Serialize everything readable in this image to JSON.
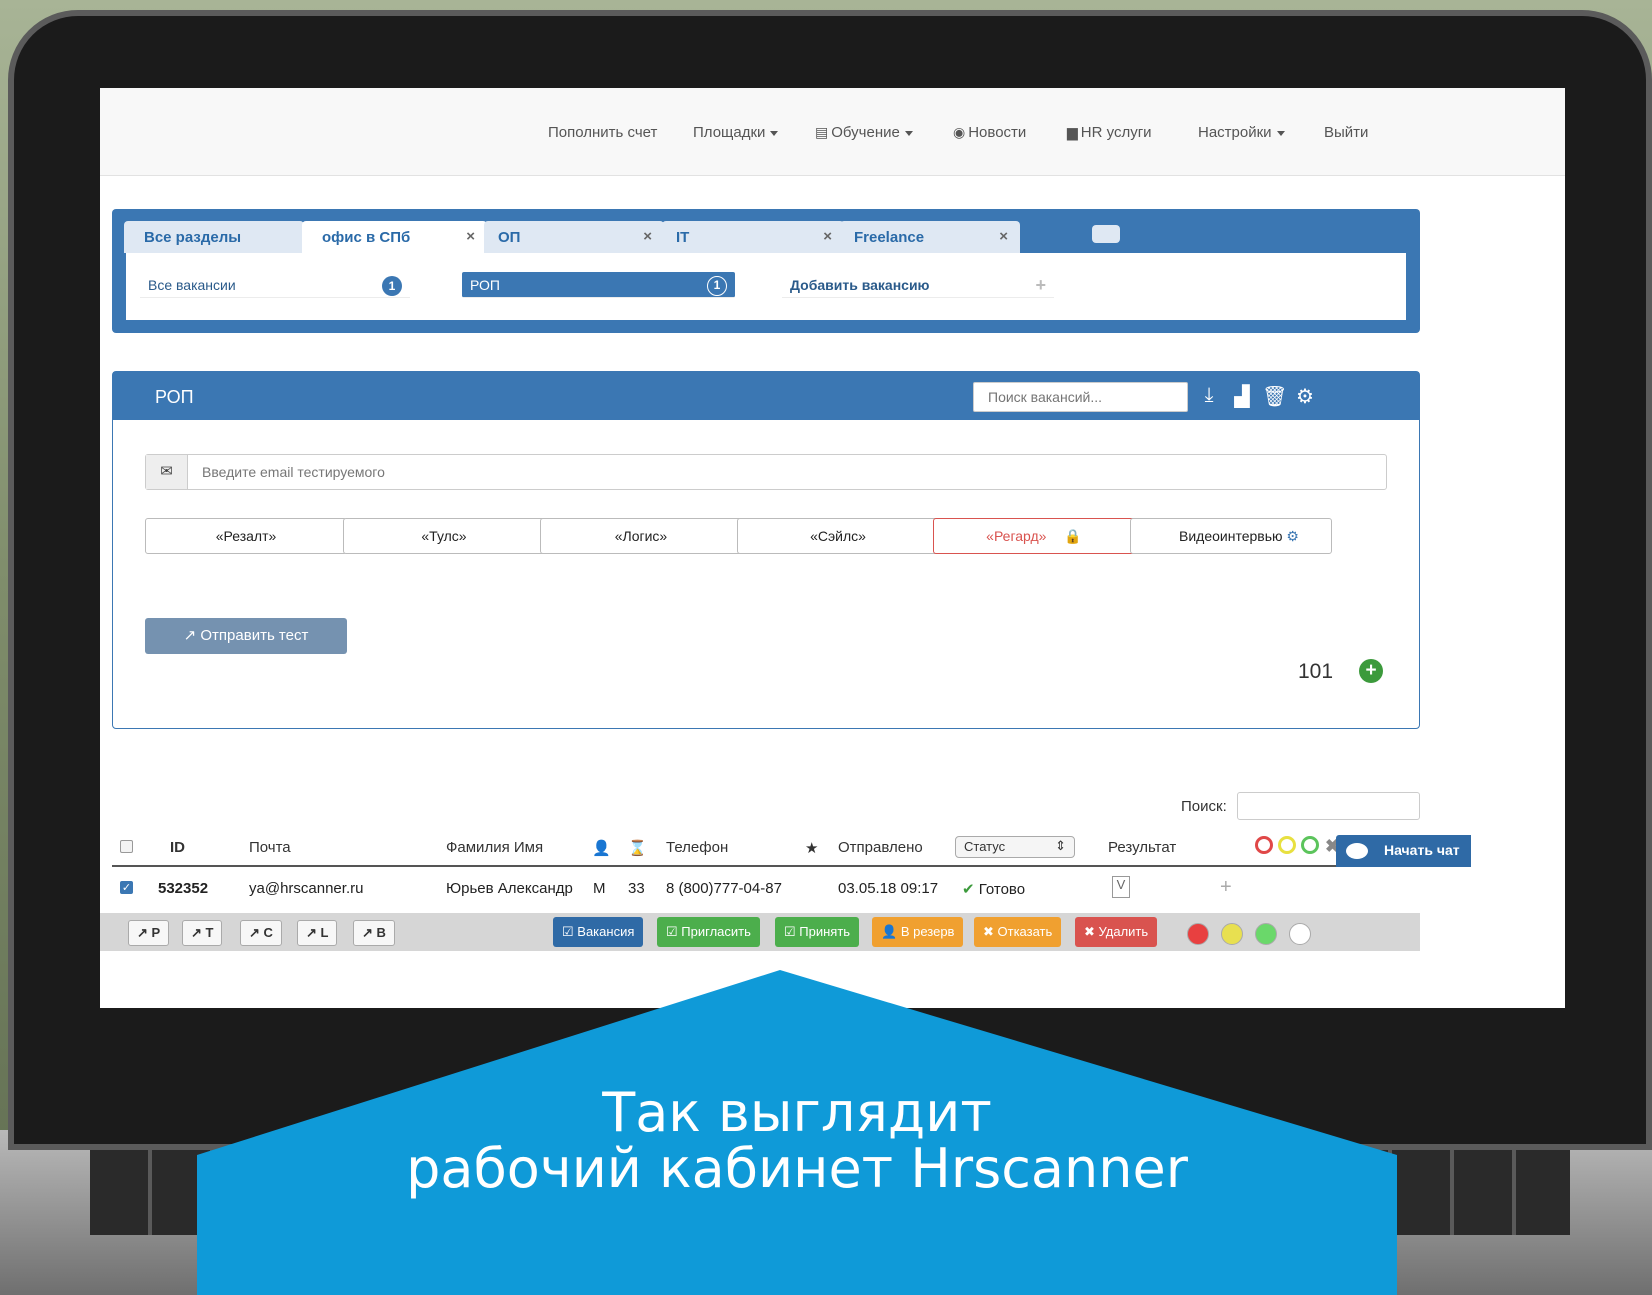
{
  "nav": {
    "topup": "Пополнить счет",
    "platforms": "Площадки",
    "training": "Обучение",
    "news": "Новости",
    "hr": "HR услуги",
    "settings": "Настройки",
    "logout": "Выйти"
  },
  "tabs": [
    {
      "label": "Все разделы"
    },
    {
      "label": "офис в СПб"
    },
    {
      "label": "ОП"
    },
    {
      "label": "IT"
    },
    {
      "label": "Freelance"
    }
  ],
  "close_glyph": "×",
  "vacancies": {
    "all": "Все вакансии",
    "all_count": "1",
    "rop": "РОП",
    "rop_count": "1",
    "add": "Добавить вакансию"
  },
  "panel": {
    "title": "РОП",
    "search_placeholder": "Поиск вакансий...",
    "email_placeholder": "Введите email тестируемого"
  },
  "tests": [
    "«Резалт»",
    "«Тулс»",
    "«Логис»",
    "«Сэйлс»",
    "«Регард»",
    "Видеоинтервью"
  ],
  "send_label": "Отправить тест",
  "count": "101",
  "table": {
    "search_label": "Поиск:",
    "headers": {
      "id": "ID",
      "email": "Почта",
      "name": "Фамилия Имя",
      "phone": "Телефон",
      "sent": "Отправлено",
      "status": "Статус",
      "result": "Результат"
    },
    "rows": [
      {
        "id": "532352",
        "email": "ya@hrscanner.ru",
        "name": "Юрьев Александр",
        "gender": "М",
        "age": "33",
        "phone": "8 (800)777-04-87",
        "sent": "03.05.18  09:17",
        "status": "Готово"
      }
    ]
  },
  "bottom": {
    "small": [
      "P",
      "T",
      "C",
      "L",
      "B"
    ],
    "vacancy": "Вакансия",
    "invite": "Пригласить",
    "accept": "Принять",
    "reserve": "В резерв",
    "reject": "Отказать",
    "delete": "Удалить"
  },
  "chat": "Начать чат",
  "overlay": {
    "line1": "Так выглядит",
    "line2": "рабочий кабинет Hrscanner"
  },
  "colors": {
    "primary": "#3b77b3",
    "banner": "#0f9ad8",
    "green": "#5cb85c",
    "orange": "#f0ad4e",
    "red": "#d9534f"
  }
}
